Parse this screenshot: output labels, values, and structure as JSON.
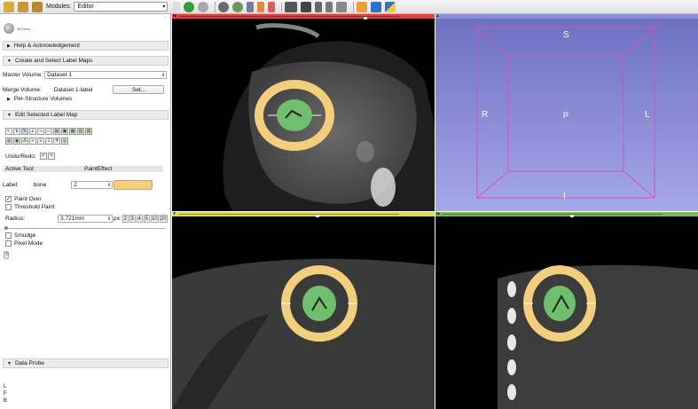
{
  "toolbar": {
    "modules_label": "Modules:",
    "module_value": "Editor"
  },
  "panel": {
    "sections": {
      "help": "Help & Acknowledgement",
      "create": "Create and Select Label Maps",
      "edit": "Edit Selected Label Map",
      "probe": "Data Probe"
    },
    "master_volume_label": "Master Volume:",
    "master_volume_value": "Dataset 1",
    "merge_volume_label": "Merge Volume:",
    "merge_volume_value": "Dataset 1-label",
    "set_button": "Set...",
    "per_structure": "Per-Structure Volumes",
    "undo_redo_label": "Undo/Redo:",
    "active_tool_label": "Active Tool:",
    "active_tool_value": "PaintEffect",
    "label_label": "Label:",
    "label_name": "bone",
    "label_value": "2",
    "label_color": "#f3cf7d",
    "paint_over": "Paint Over",
    "threshold_paint": "Threshold Paint",
    "radius_label": "Radius:",
    "radius_value": "3.721mm",
    "px_label": "px:",
    "px_buttons": [
      "2",
      "3",
      "4",
      "5",
      "10",
      "20"
    ],
    "smudge": "Smudge",
    "pixel_mode": "Pixel Mode",
    "help_q": "?",
    "probe_lines": [
      "L",
      "F",
      "B"
    ]
  },
  "views": {
    "red": {
      "letter": "R",
      "color": "#e0413b"
    },
    "three_d": {
      "letter": "1",
      "color": "#8b8fd6",
      "labels": {
        "top": "S",
        "left": "R",
        "center": "P",
        "right": "L",
        "bottom": "I"
      }
    },
    "yellow": {
      "letter": "Y",
      "color": "#e4d94a"
    },
    "green": {
      "letter": "G",
      "color": "#6fbf4a"
    }
  }
}
